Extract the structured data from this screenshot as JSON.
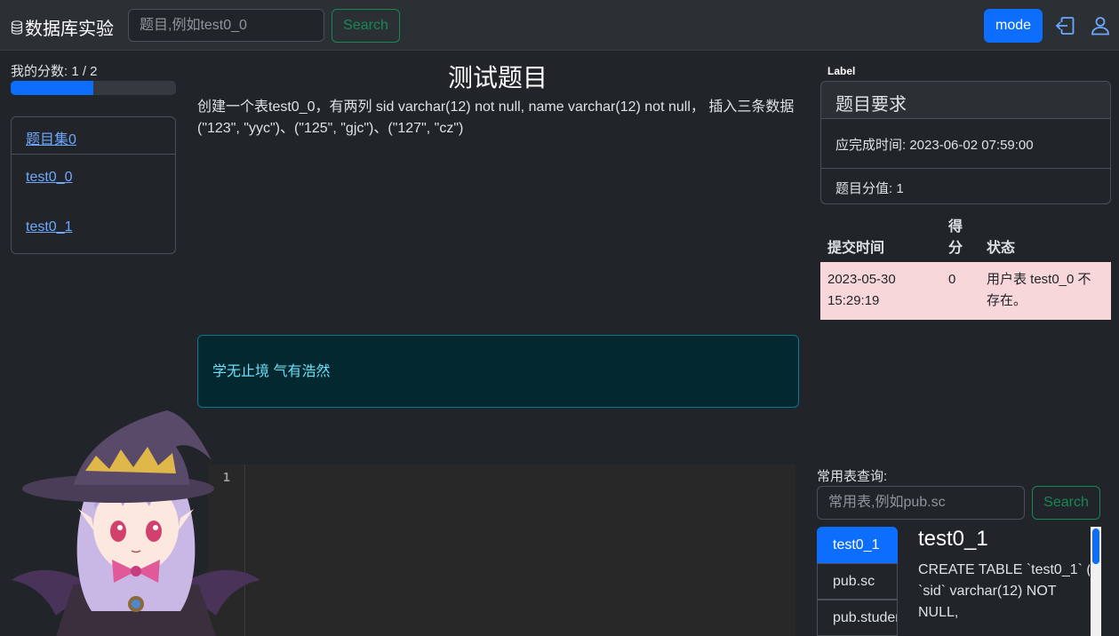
{
  "navbar": {
    "brand": "数据库实验",
    "search_placeholder": "题目,例如test0_0",
    "search_button": "Search",
    "mode_button": "mode"
  },
  "sidebar": {
    "score_label": "我的分数:   1 / 2",
    "progress_fraction": 0.5,
    "set_title": "题目集0",
    "items": [
      {
        "label": "test0_0"
      },
      {
        "label": "test0_1"
      }
    ]
  },
  "main": {
    "title": "测试题目",
    "description": "创建一个表test0_0，有两列 sid varchar(12) not null, name varchar(12) not null， 插入三条数据(\"123\", \"yyc\")、(\"125\", \"gjc\")、(\"127\", \"cz\")",
    "alert_text": "学无止境 气有浩然",
    "editor_line_number": "1"
  },
  "right_panel": {
    "label": "Label",
    "requirements": {
      "header": "题目要求",
      "deadline": "应完成时间: 2023-06-02 07:59:00",
      "points": "题目分值: 1"
    },
    "submissions": {
      "headers": {
        "time": "提交时间",
        "score_line1": "得",
        "score_line2": "分",
        "status": "状态"
      },
      "rows": [
        {
          "time_line1": "2023-05-30",
          "time_line2": "15:29:19",
          "score": "0",
          "status_line1": "用户表 test0_0 不",
          "status_line2": "存在。"
        }
      ]
    },
    "common_tables": {
      "label": "常用表查询:",
      "search_placeholder": "常用表,例如pub.sc",
      "search_button": "Search",
      "tabs": [
        {
          "label": "test0_1"
        },
        {
          "label": "pub.sc"
        },
        {
          "label": "pub.student"
        }
      ],
      "active_title": "test0_1",
      "active_sql": "CREATE TABLE `test0_1` (\n`sid` varchar(12) NOT NULL,"
    }
  },
  "colors": {
    "background": "#212529",
    "primary": "#0d6efd",
    "success": "#198754",
    "danger_row": "#f8d7da",
    "info_bg": "#032830"
  }
}
